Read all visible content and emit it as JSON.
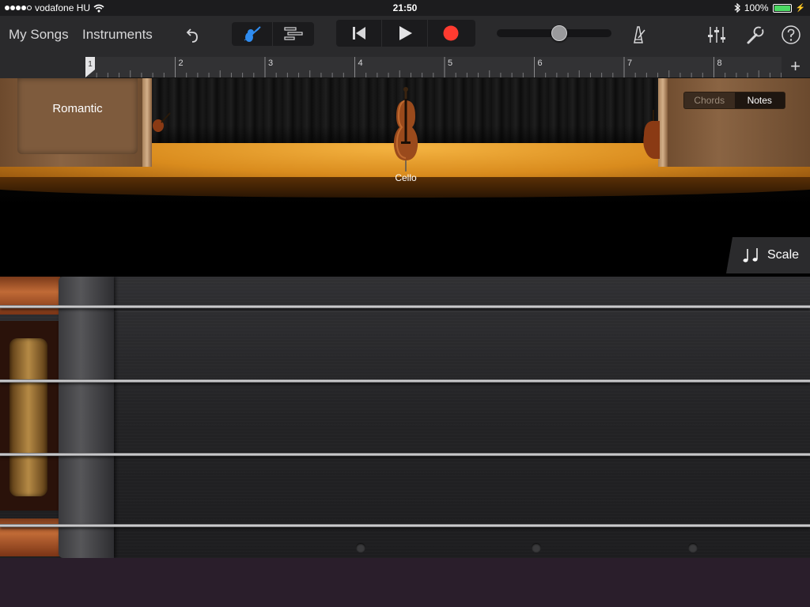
{
  "status_bar": {
    "carrier": "vodafone HU",
    "time": "21:50",
    "battery": "100%",
    "battery_level": 1.0
  },
  "toolbar": {
    "my_songs": "My Songs",
    "instruments": "Instruments",
    "volume_level": 0.55,
    "icons": [
      "undo-icon",
      "instrument-view-icon",
      "tracks-view-icon",
      "rewind-icon",
      "play-icon",
      "record-icon",
      "metronome-icon",
      "mixer-icon",
      "settings-wrench-icon",
      "help-icon"
    ],
    "accent_color": "#2f8cf0",
    "record_color": "#ff3b30"
  },
  "ruler": {
    "bars": [
      "1",
      "2",
      "3",
      "4",
      "5",
      "6",
      "7",
      "8"
    ],
    "add_label": "+"
  },
  "stage": {
    "title": "Romantic",
    "instrument": "Cello",
    "mode_options": [
      "Chords",
      "Notes"
    ],
    "mode_selected": "Notes"
  },
  "scale": {
    "label": "Scale"
  },
  "strings": {
    "count": 4
  }
}
